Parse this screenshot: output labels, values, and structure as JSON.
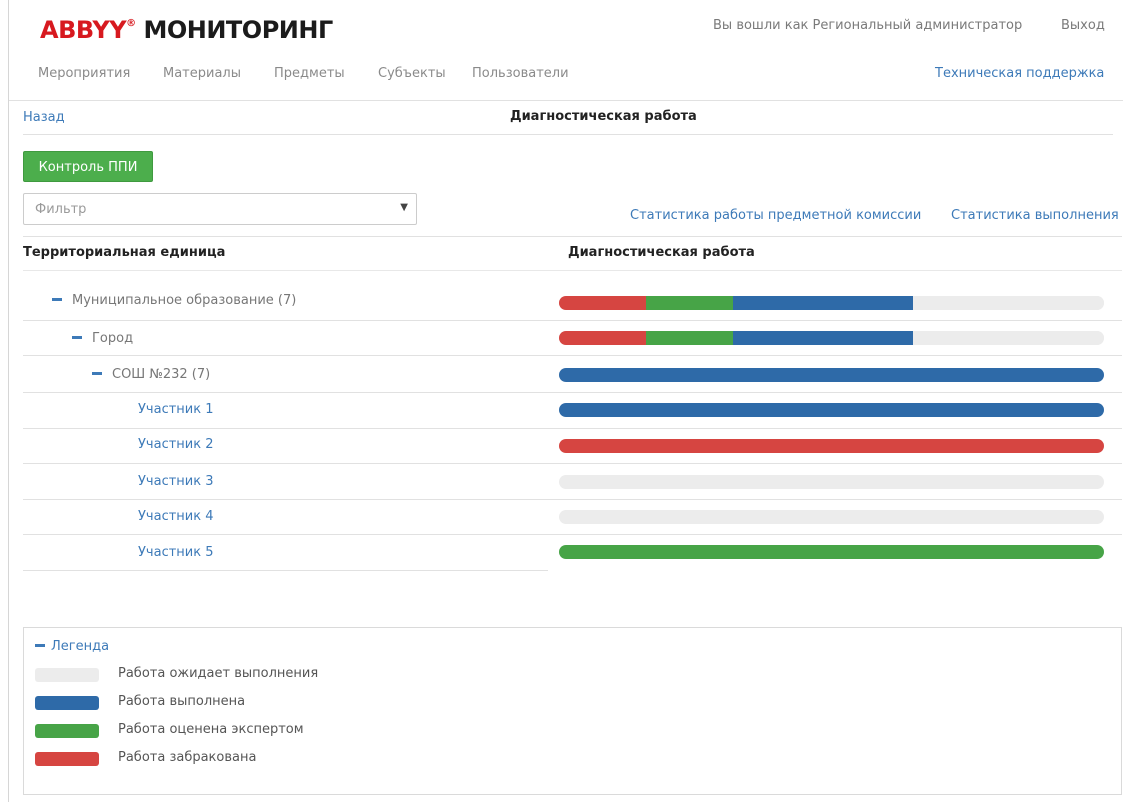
{
  "header": {
    "logo_brand": "ABBYY",
    "logo_tm": "®",
    "logo_product": "МОНИТОРИНГ",
    "user_info": "Вы вошли как Региональный администратор",
    "logout": "Выход"
  },
  "nav": {
    "items": [
      "Мероприятия",
      "Материалы",
      "Предметы",
      "Субъекты",
      "Пользователи"
    ],
    "support": "Техническая поддержка"
  },
  "breadcrumb": {
    "back": "Назад",
    "title": "Диагностическая работа"
  },
  "toolbar": {
    "ppi_button": "Контроль ППИ",
    "filter_placeholder": "Фильтр",
    "filter_caret": "▼",
    "stats_commission": "Статистика работы предметной комиссии",
    "stats_completion": "Статистика выполнения"
  },
  "table": {
    "col_territory": "Территориальная единица",
    "col_work": "Диагностическая работа",
    "rows": [
      {
        "label": "Муниципальное образование  (7)",
        "progress": {
          "rejected": 0.16,
          "expert": 0.16,
          "done": 0.33,
          "waiting": 0.35
        }
      },
      {
        "label": "Город",
        "progress": {
          "rejected": 0.16,
          "expert": 0.16,
          "done": 0.33,
          "waiting": 0.35
        }
      },
      {
        "label": "СОШ №232 (7)",
        "progress": {
          "rejected": 0,
          "expert": 0,
          "done": 1,
          "waiting": 0
        }
      },
      {
        "label": "Участник 1",
        "progress": {
          "rejected": 0,
          "expert": 0,
          "done": 1,
          "waiting": 0
        }
      },
      {
        "label": "Участник 2",
        "progress": {
          "rejected": 1,
          "expert": 0,
          "done": 0,
          "waiting": 0
        }
      },
      {
        "label": "Участник 3",
        "progress": {
          "rejected": 0,
          "expert": 0,
          "done": 0,
          "waiting": 1
        }
      },
      {
        "label": "Участник 4",
        "progress": {
          "rejected": 0,
          "expert": 0,
          "done": 0,
          "waiting": 1
        }
      },
      {
        "label": "Участник 5",
        "progress": {
          "rejected": 0,
          "expert": 1,
          "done": 0,
          "waiting": 0
        }
      }
    ]
  },
  "legend": {
    "toggle": "Легенда",
    "items": [
      {
        "label": "Работа ожидает выполнения",
        "color": "#ececec"
      },
      {
        "label": "Работа выполнена",
        "color": "#2e6aa8"
      },
      {
        "label": "Работа оценена экспертом",
        "color": "#47a447"
      },
      {
        "label": "Работа забракована",
        "color": "#d64541"
      }
    ]
  },
  "colors": {
    "rejected": "#d64541",
    "expert": "#47a447",
    "done": "#2e6aa8",
    "waiting": "#ececec",
    "link": "#3d7ab8",
    "button_green": "#4cae4c"
  }
}
